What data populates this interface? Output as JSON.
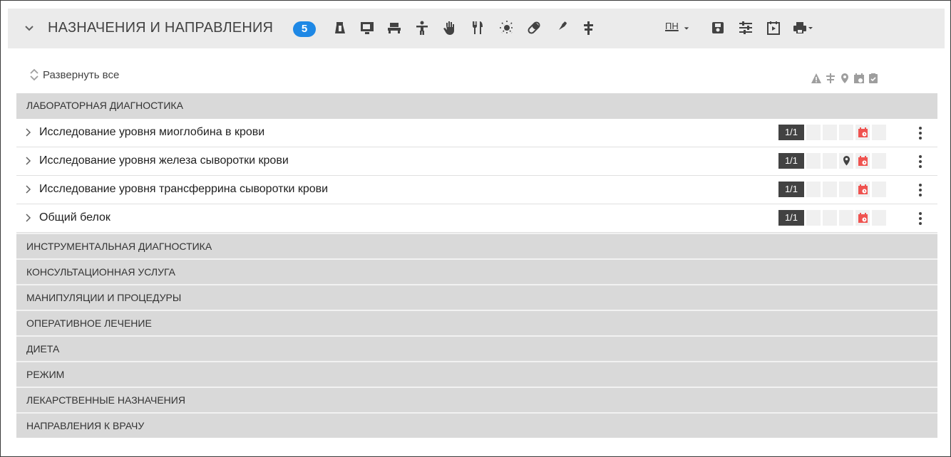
{
  "header": {
    "title": "НАЗНАЧЕНИЯ И НАПРАВЛЕНИЯ",
    "badge_count": "5",
    "menu_label": "пн",
    "icons": [
      "lab-flask-icon",
      "monitor-icon",
      "bed-icon",
      "person-icon",
      "hand-icon",
      "fork-knife-icon",
      "sun-icon",
      "pill-icon",
      "syringe-icon",
      "plus-cross-icon"
    ],
    "right_icons": [
      "calendar-week-icon",
      "save-icon",
      "filter-sliders-icon",
      "play-calendar-icon",
      "print-icon"
    ]
  },
  "toolbar": {
    "expand_all_label": "Развернуть все"
  },
  "column_icons": [
    "warning-icon",
    "filter-icon",
    "location-icon",
    "calendar-clock-icon",
    "clipboard-check-icon"
  ],
  "groups": [
    {
      "title": "ЛАБОРАТОРНАЯ ДИАГНОСТИКА",
      "rows": [
        {
          "label": "Исследование уровня миоглобина в крови",
          "count": "1/1",
          "location": false,
          "scheduled": true
        },
        {
          "label": "Исследование уровня железа сыворотки крови",
          "count": "1/1",
          "location": true,
          "scheduled": true
        },
        {
          "label": "Исследование уровня трансферрина сыворотки крови",
          "count": "1/1",
          "location": false,
          "scheduled": true
        },
        {
          "label": "Общий белок",
          "count": "1/1",
          "location": false,
          "scheduled": true
        }
      ]
    },
    {
      "title": "ИНСТРУМЕНТАЛЬНАЯ ДИАГНОСТИКА"
    },
    {
      "title": "КОНСУЛЬТАЦИОННАЯ УСЛУГА"
    },
    {
      "title": "МАНИПУЛЯЦИИ И ПРОЦЕДУРЫ"
    },
    {
      "title": "ОПЕРАТИВНОЕ ЛЕЧЕНИЕ"
    },
    {
      "title": "ДИЕТА"
    },
    {
      "title": "РЕЖИМ"
    },
    {
      "title": "ЛЕКАРСТВЕННЫЕ НАЗНАЧЕНИЯ"
    },
    {
      "title": "НАПРАВЛЕНИЯ К ВРАЧУ"
    }
  ],
  "colors": {
    "badge": "#1e88e5",
    "schedule": "#ef5350",
    "count_bg": "#424242",
    "group_bg": "#d9d9d9",
    "header_bg": "#ebebeb"
  }
}
